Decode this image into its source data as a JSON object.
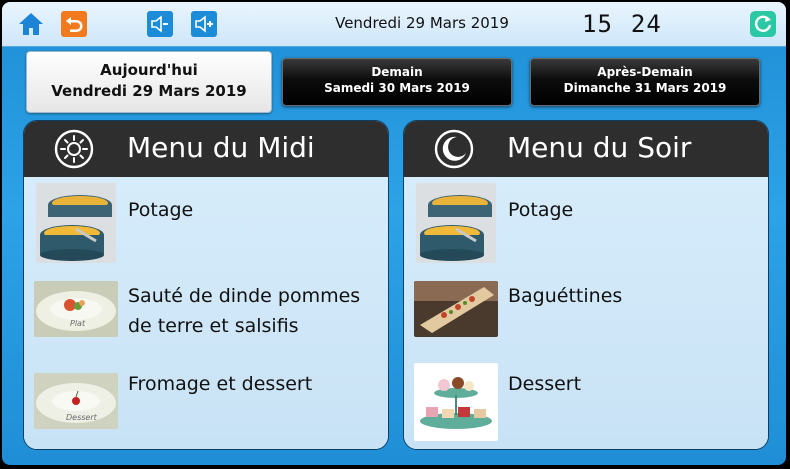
{
  "topbar": {
    "date": "Vendredi 29 Mars 2019",
    "clock_hours": "15",
    "clock_minutes": "24",
    "icons": [
      "home-icon",
      "back-arrow-icon",
      "volume-down-icon",
      "volume-up-icon",
      "refresh-icon"
    ]
  },
  "tabs": {
    "today": {
      "line1": "Aujourd'hui",
      "line2": "Vendredi 29 Mars 2019"
    },
    "tomorrow": {
      "line1": "Demain",
      "line2": "Samedi 30 Mars 2019"
    },
    "after": {
      "line1": "Après-Demain",
      "line2": "Dimanche 31 Mars 2019"
    }
  },
  "midi": {
    "title": "Menu du Midi",
    "icon": "sun-icon",
    "items": [
      {
        "label": "Potage",
        "image": "soup-photo"
      },
      {
        "label": "Sauté de dinde pommes de terre et salsifis",
        "image": "plat-photo"
      },
      {
        "label": "Fromage et dessert",
        "image": "dessert-plate-photo"
      }
    ]
  },
  "soir": {
    "title": "Menu du Soir",
    "icon": "moon-icon",
    "items": [
      {
        "label": "Potage",
        "image": "soup-photo"
      },
      {
        "label": "Baguéttines",
        "image": "baguettines-photo"
      },
      {
        "label": "Dessert",
        "image": "cakes-photo"
      }
    ]
  },
  "colors": {
    "background": "#1f8ed6",
    "topbar": "#e3f1fd",
    "panel_header": "#2e2e2e",
    "panel_body": "#cfe7f7",
    "back_button": "#f27a1e",
    "refresh_button": "#2bc8a6"
  }
}
